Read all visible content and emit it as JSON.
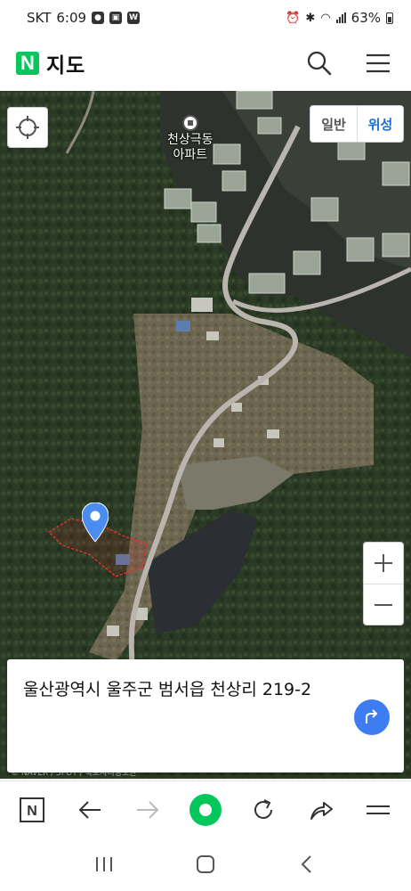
{
  "status_bar": {
    "carrier": "SKT",
    "time": "6:09",
    "battery": "63%"
  },
  "header": {
    "logo": "N",
    "title": "지도",
    "icons": [
      "search-icon",
      "menu-icon"
    ]
  },
  "map": {
    "landmark_label": "천상극동\n아파트",
    "map_type": {
      "normal_label": "일반",
      "satellite_label": "위성",
      "selected": "위성"
    },
    "zoom_in": "+",
    "zoom_out": "−",
    "copyright": "© NAVER / SPOT / 국토지리정보원",
    "colors": {
      "pin": "#4a8cf0",
      "parcel_outline": "#e03030",
      "road": "#b9b4ad"
    }
  },
  "address_card": {
    "address": "울산광역시 울주군 범서읍 천상리 219-2",
    "route_button_color": "#3d7cf1"
  },
  "toolbar": {
    "icons": [
      "naver-n-icon",
      "back-arrow-icon",
      "forward-arrow-icon",
      "green-home-icon",
      "refresh-icon",
      "share-icon",
      "menu-icon"
    ],
    "forward_disabled": true
  },
  "navbar": {
    "icons": [
      "recent-apps-icon",
      "home-icon",
      "back-icon"
    ]
  }
}
